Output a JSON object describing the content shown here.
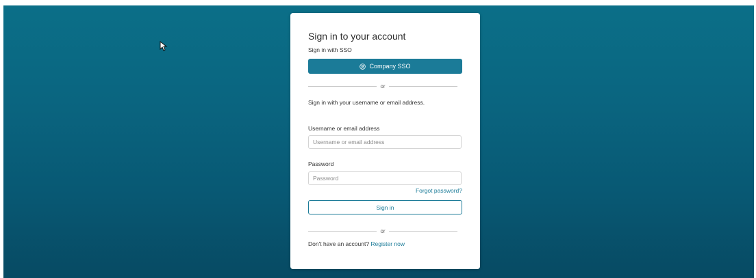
{
  "login": {
    "title": "Sign in to your account",
    "sso_label": "Sign in with SSO",
    "sso_button": "Company SSO",
    "divider_text": "or",
    "intro": "Sign in with your username or email address.",
    "username": {
      "label": "Username or email address",
      "placeholder": "Username or email address",
      "value": ""
    },
    "password": {
      "label": "Password",
      "placeholder": "Password",
      "value": ""
    },
    "forgot_link": "Forgot password?",
    "signin_button": "Sign in",
    "register_prompt": "Don't have an account?",
    "register_link": "Register now"
  },
  "icons": {
    "sso": "user-circle-icon",
    "cursor": "mouse-pointer-icon"
  },
  "colors": {
    "background": "#0a6580",
    "accent": "#1b7b98",
    "card": "#ffffff"
  }
}
